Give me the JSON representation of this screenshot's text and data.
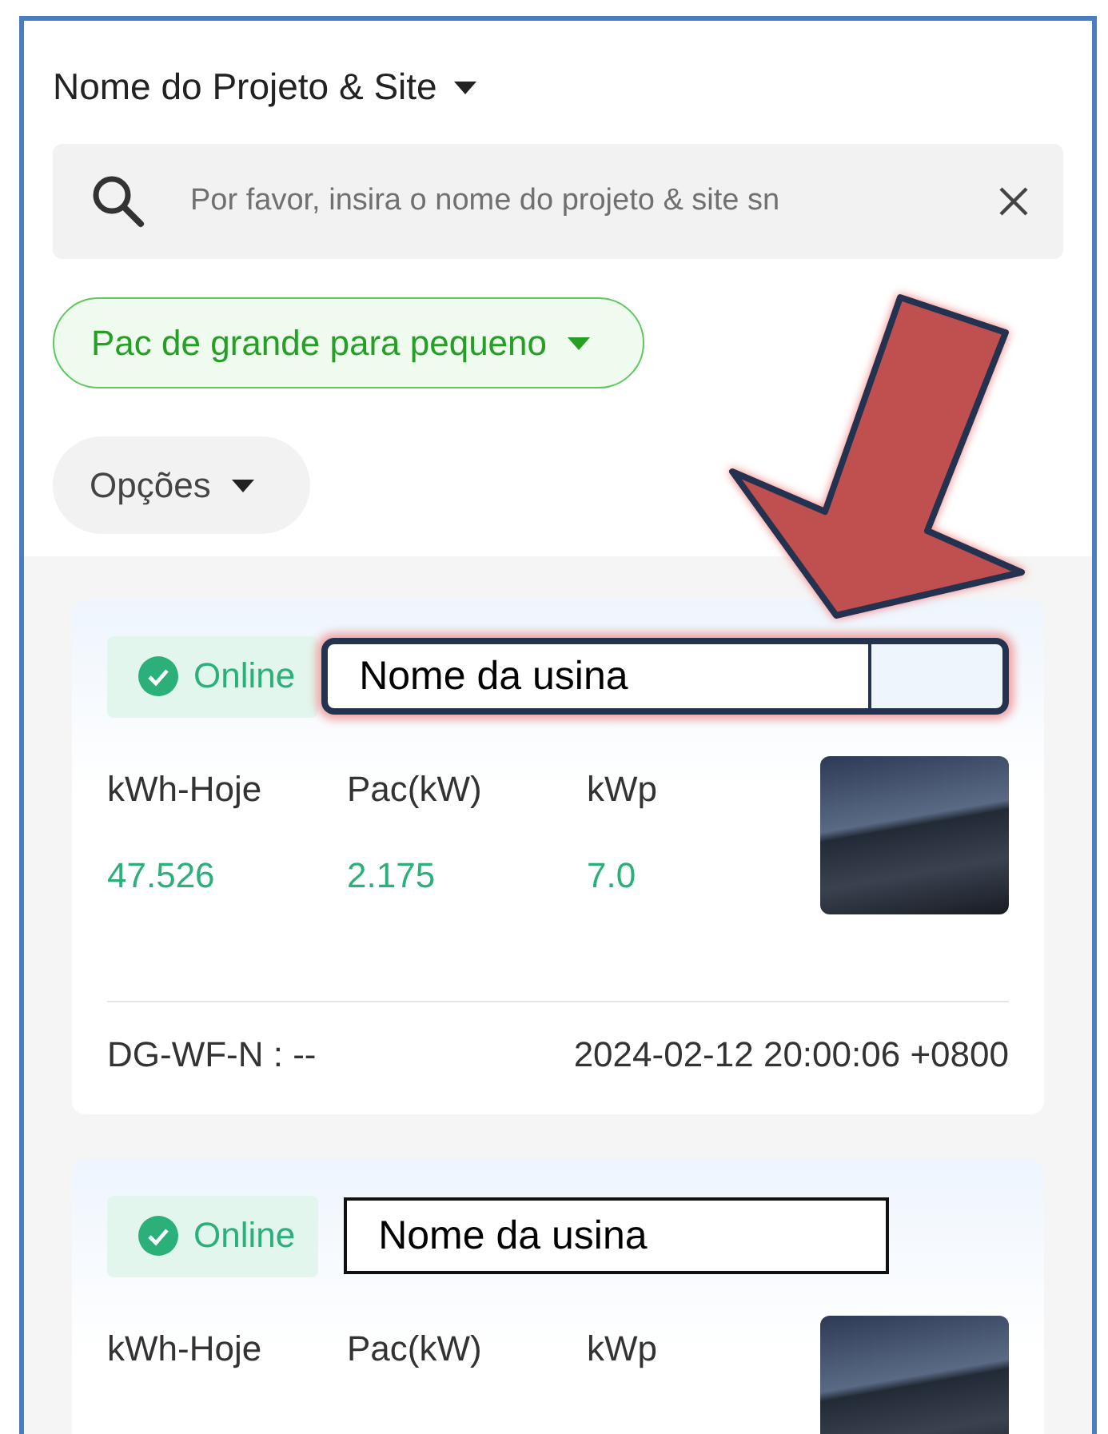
{
  "header": {
    "title": "Nome do Projeto & Site",
    "search": {
      "placeholder": "Por favor, insira o nome do projeto & site sn"
    },
    "sort": {
      "label": "Pac de grande para pequeno"
    },
    "options": {
      "label": "Opções"
    }
  },
  "cards": [
    {
      "status": "Online",
      "name_label": "Nome da usina",
      "highlighted": true,
      "metrics": [
        {
          "label": "kWh-Hoje",
          "value": "47.526"
        },
        {
          "label": "Pac(kW)",
          "value": "2.175"
        },
        {
          "label": "kWp",
          "value": "7.0"
        }
      ],
      "device": "DG-WF-N : --",
      "timestamp": "2024-02-12 20:00:06 +0800"
    },
    {
      "status": "Online",
      "name_label": "Nome da usina",
      "highlighted": false,
      "metrics": [
        {
          "label": "kWh-Hoje"
        },
        {
          "label": "Pac(kW)"
        },
        {
          "label": "kWp"
        }
      ]
    }
  ],
  "annotation": {
    "kind": "arrow"
  }
}
